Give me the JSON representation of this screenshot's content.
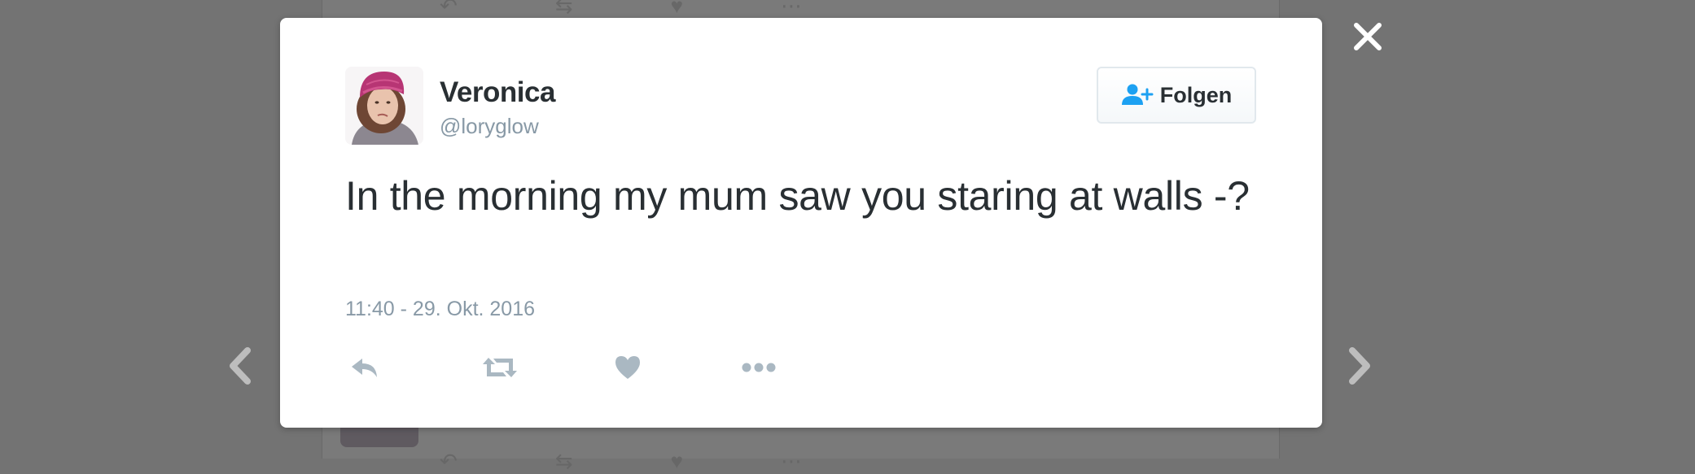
{
  "tweet": {
    "user_name": "Veronica",
    "user_handle": "@loryglow",
    "text": "In the morning my mum saw you staring at walls -?",
    "timestamp": "11:40 - 29. Okt. 2016",
    "follow_label": "Folgen"
  },
  "icons": {
    "follow": "add-user-icon",
    "reply": "reply-icon",
    "retweet": "retweet-icon",
    "like": "heart-icon",
    "more": "more-dots-icon",
    "close": "close-icon",
    "prev": "chevron-left-icon",
    "next": "chevron-right-icon"
  },
  "colors": {
    "backdrop": "#737373",
    "card": "#ffffff",
    "name": "#292f33",
    "secondary": "#8899a6",
    "accent": "#1da1f2",
    "action_icons": "#aab8c2"
  }
}
